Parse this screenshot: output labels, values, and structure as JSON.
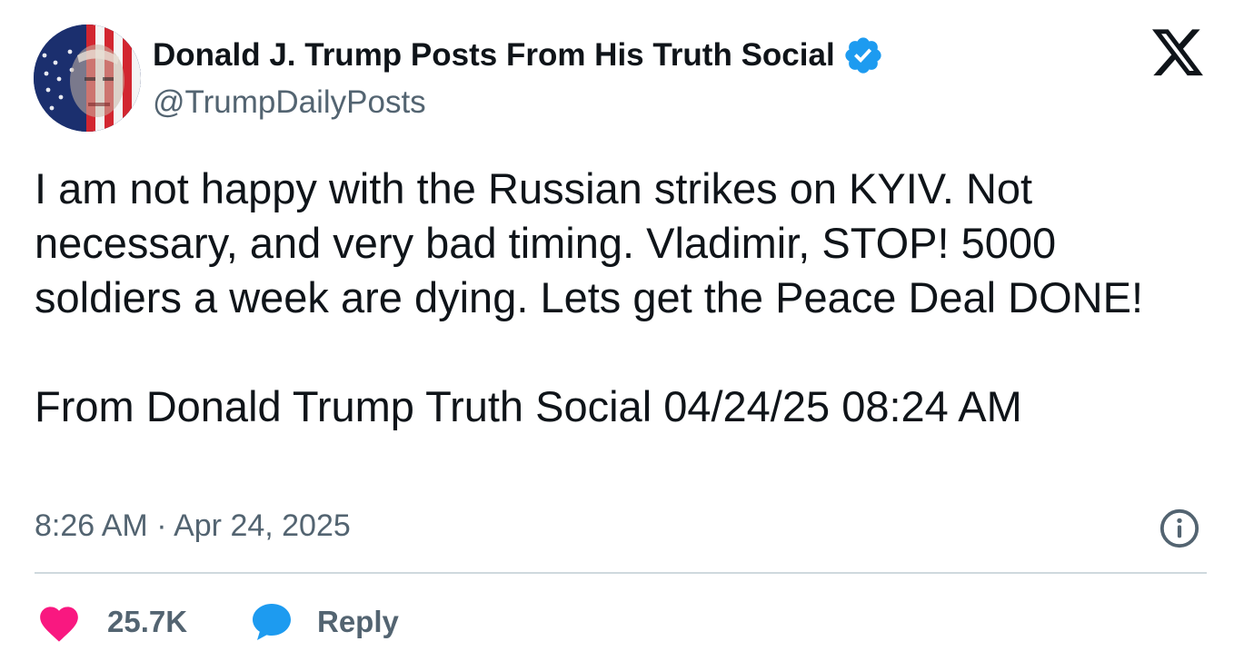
{
  "author": {
    "display_name": "Donald J. Trump Posts From His Truth Social",
    "handle": "@TrumpDailyPosts",
    "avatar_icon": "flag-portrait-avatar",
    "verified_icon": "verified-badge-icon"
  },
  "platform_icon": "x-logo-icon",
  "post": {
    "paragraphs": [
      "I am not happy with the Russian strikes on KYIV. Not necessary, and very bad timing. Vladimir, STOP! 5000 soldiers a week are dying. Lets get the Peace Deal DONE!",
      "From Donald Trump Truth Social 04/24/25 08:24 AM"
    ],
    "timestamp": "8:26 AM · Apr 24, 2025"
  },
  "actions": {
    "like_count": "25.7K",
    "reply_label": "Reply"
  },
  "colors": {
    "text": "#0f1419",
    "secondary": "#536471",
    "verified": "#1d9bf0",
    "like": "#f91880",
    "reply": "#1d9bf0",
    "divider": "#cfd9de"
  }
}
